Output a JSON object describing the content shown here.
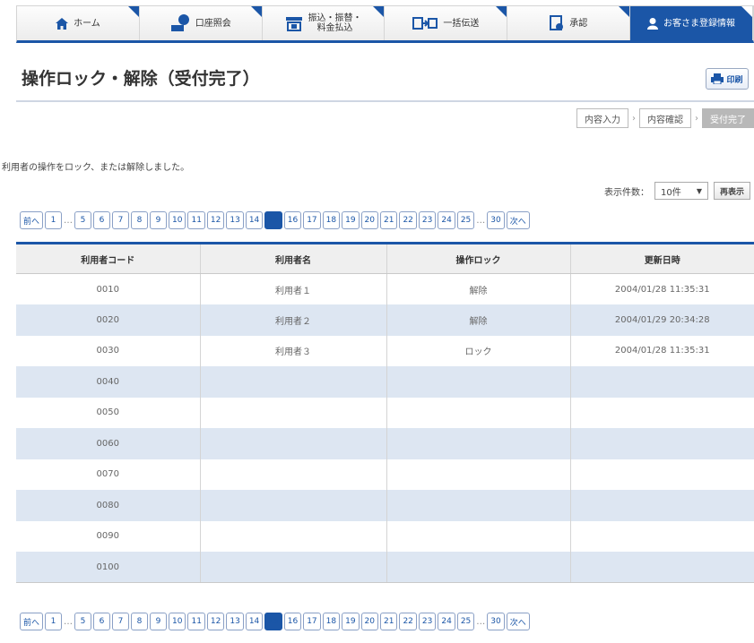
{
  "nav": [
    {
      "label": "ホーム",
      "icon": "home-icon"
    },
    {
      "label": "口座照会",
      "icon": "account-icon"
    },
    {
      "label": "振込・振替・\n料金払込",
      "icon": "transfer-icon"
    },
    {
      "label": "一括伝送",
      "icon": "bulk-transfer-icon"
    },
    {
      "label": "承認",
      "icon": "approval-icon"
    },
    {
      "label": "お客さま登録情報",
      "icon": "user-icon"
    }
  ],
  "page": {
    "title": "操作ロック・解除（受付完了）",
    "print_label": "印刷",
    "message": "利用者の操作をロック、または解除しました。"
  },
  "steps": [
    "内容入力",
    "内容確認",
    "受付完了"
  ],
  "display_count": {
    "label": "表示件数：",
    "value": "10件",
    "redisplay": "再表示"
  },
  "pager": {
    "prev": "前へ",
    "next": "次へ",
    "pages": [
      "1",
      "…",
      "5",
      "6",
      "7",
      "8",
      "9",
      "10",
      "11",
      "12",
      "13",
      "14",
      "15",
      "16",
      "17",
      "18",
      "19",
      "20",
      "21",
      "22",
      "23",
      "24",
      "25",
      "…",
      "30"
    ],
    "current": "15"
  },
  "table": {
    "headers": [
      "利用者コード",
      "利用者名",
      "操作ロック",
      "更新日時"
    ],
    "rows": [
      [
        "0010",
        "利用者１",
        "解除",
        "2004/01/28 11:35:31"
      ],
      [
        "0020",
        "利用者２",
        "解除",
        "2004/01/29 20:34:28"
      ],
      [
        "0030",
        "利用者３",
        "ロック",
        "2004/01/28 11:35:31"
      ],
      [
        "0040",
        "",
        "",
        ""
      ],
      [
        "0050",
        "",
        "",
        ""
      ],
      [
        "0060",
        "",
        "",
        ""
      ],
      [
        "0070",
        "",
        "",
        ""
      ],
      [
        "0080",
        "",
        "",
        ""
      ],
      [
        "0090",
        "",
        "",
        ""
      ],
      [
        "0100",
        "",
        "",
        ""
      ]
    ]
  },
  "colors": {
    "brand": "#1b56a7",
    "row_alt": "#dde6f2"
  }
}
